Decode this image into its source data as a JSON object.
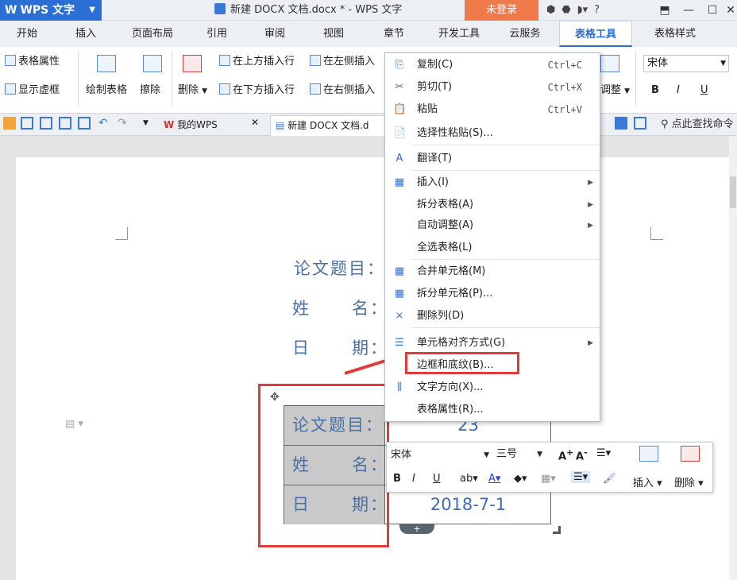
{
  "titlebar": {
    "app_label": "WPS 文字",
    "doc_title": "新建 DOCX 文档.docx * - WPS 文字",
    "login": "未登录",
    "help": "?"
  },
  "tabs": [
    "开始",
    "插入",
    "页面布局",
    "引用",
    "审阅",
    "视图",
    "章节",
    "开发工具",
    "云服务",
    "表格工具",
    "表格样式"
  ],
  "ribbon": {
    "table_props": "表格属性",
    "show_grid": "显示虚框",
    "draw_table": "绘制表格",
    "eraser": "擦除",
    "delete": "删除",
    "insert_above": "在上方插入行",
    "insert_left": "在左侧插入",
    "insert_below": "在下方插入行",
    "insert_right": "在右侧插入",
    "adjust": "调整",
    "font": "宋体",
    "bold": "B",
    "italic": "I",
    "underline": "U"
  },
  "qat": {
    "my_wps": "我的WPS",
    "doc_tab": "新建 DOCX 文档.d",
    "search_hint": "点此查找命令"
  },
  "document": {
    "lines": [
      {
        "label": "论文题目："
      },
      {
        "label": "姓      名："
      },
      {
        "label": "日      期："
      }
    ],
    "table": [
      {
        "label": "论文题目：",
        "value": "23"
      },
      {
        "label": "姓      名：",
        "value": ""
      },
      {
        "label": "日      期：",
        "value": "2018-7-1"
      }
    ]
  },
  "context_menu": [
    {
      "icon": "copy-icon",
      "glyph": "⎘",
      "label": "复制(C)",
      "shortcut": "Ctrl+C"
    },
    {
      "icon": "cut-icon",
      "glyph": "✂",
      "label": "剪切(T)",
      "shortcut": "Ctrl+X"
    },
    {
      "icon": "paste-icon",
      "glyph": "📋",
      "label": "粘贴",
      "shortcut": "Ctrl+V"
    },
    {
      "icon": "paste-special-icon",
      "glyph": "📄",
      "label": "选择性粘贴(S)..."
    },
    {
      "icon": "translate-icon",
      "glyph": "A",
      "label": "翻译(T)"
    },
    {
      "icon": "insert-icon",
      "glyph": "▦",
      "label": "插入(I)",
      "submenu": true
    },
    {
      "icon": "",
      "glyph": "",
      "label": "拆分表格(A)",
      "submenu": true
    },
    {
      "icon": "",
      "glyph": "",
      "label": "自动调整(A)",
      "submenu": true
    },
    {
      "icon": "",
      "glyph": "",
      "label": "全选表格(L)"
    },
    {
      "icon": "merge-cells-icon",
      "glyph": "▦",
      "label": "合并单元格(M)"
    },
    {
      "icon": "split-cells-icon",
      "glyph": "▦",
      "label": "拆分单元格(P)..."
    },
    {
      "icon": "delete-column-icon",
      "glyph": "⨯",
      "label": "删除列(D)"
    },
    {
      "icon": "cell-align-icon",
      "glyph": "☰",
      "label": "单元格对齐方式(G)",
      "submenu": true
    },
    {
      "icon": "",
      "glyph": "",
      "label": "边框和底纹(B)..."
    },
    {
      "icon": "text-direction-icon",
      "glyph": "⫼",
      "label": "文字方向(X)..."
    },
    {
      "icon": "",
      "glyph": "",
      "label": "表格属性(R)..."
    }
  ],
  "mini_toolbar": {
    "font": "宋体",
    "size": "三号",
    "grow": "A",
    "shrink": "A",
    "bold": "B",
    "italic": "I",
    "underline": "U",
    "insert": "插入",
    "delete": "删除"
  },
  "colors": {
    "accent": "#2b6fd6",
    "login": "#f07a4a",
    "highlight": "#e23a3a",
    "doc_text": "#4a6fa5",
    "cell_fill": "#c9c9c9"
  }
}
